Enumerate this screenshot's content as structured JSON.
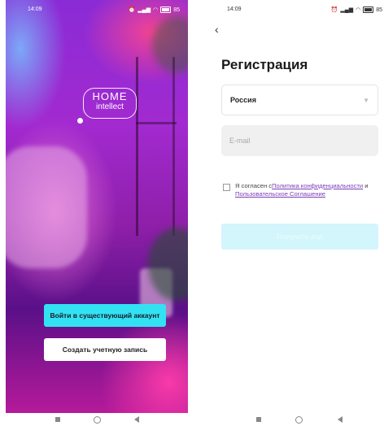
{
  "left_screen": {
    "status": {
      "time": "14:09",
      "battery": "85"
    },
    "logo": {
      "line1": "HOME",
      "line2": "intellect"
    },
    "buttons": {
      "login_label": "Войти в существующий аккаунт",
      "create_label": "Создать учетную запись"
    }
  },
  "right_screen": {
    "status": {
      "time": "14:09",
      "battery": "85"
    },
    "title": "Регистрация",
    "country": {
      "value": "Россия"
    },
    "email": {
      "placeholder": "E-mail"
    },
    "agreement": {
      "prefix": "Я согласен с",
      "privacy_link": "Политика конфиденциальности",
      "conjunction": " и ",
      "terms_link": "Пользовательское Соглашение"
    },
    "next_button_label": "Получить код"
  },
  "colors": {
    "accent_cyan": "#32e2f2",
    "link_purple": "#7a3db8",
    "disabled_button": "#d2f6fb"
  },
  "icons": [
    "alarm-icon",
    "signal-icon",
    "wifi-icon",
    "battery-icon",
    "back-icon",
    "chevron-down-icon",
    "checkbox-icon",
    "nav-recent-icon",
    "nav-home-icon",
    "nav-back-icon"
  ]
}
